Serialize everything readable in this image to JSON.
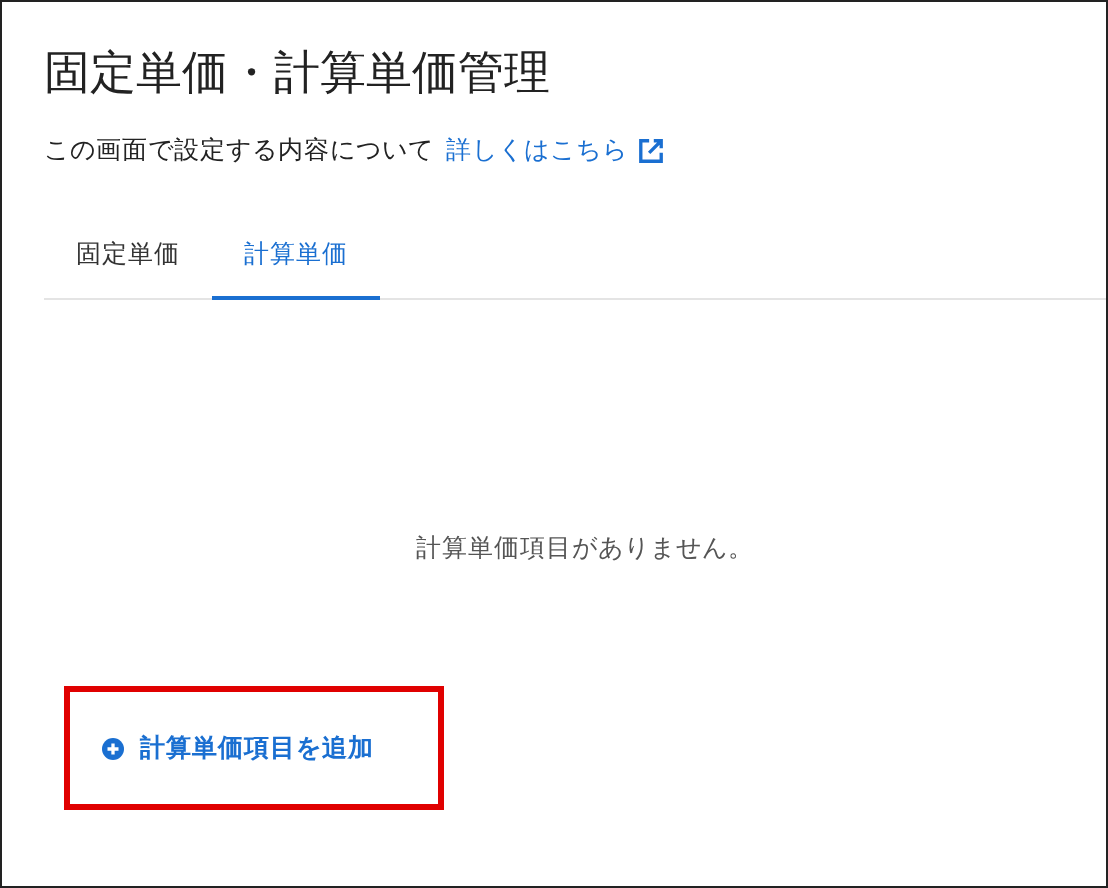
{
  "title": "固定単価・計算単価管理",
  "description": {
    "text": "この画面で設定する内容について",
    "link": "詳しくはこちら"
  },
  "tabs": [
    {
      "label": "固定単価",
      "selected": false
    },
    {
      "label": "計算単価",
      "selected": true
    }
  ],
  "empty_message": "計算単価項目がありません。",
  "add_button": {
    "label": "計算単価項目を追加",
    "highlighted": true
  }
}
